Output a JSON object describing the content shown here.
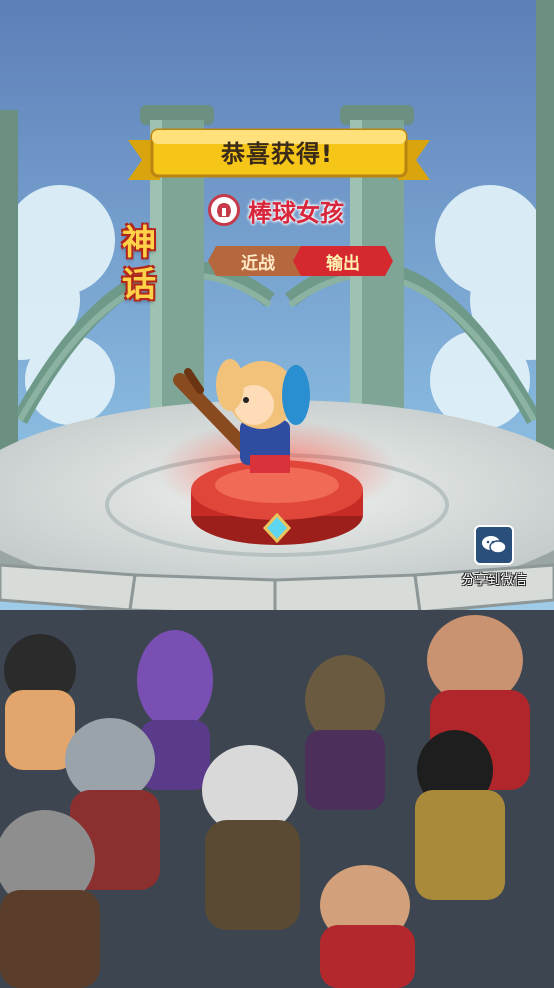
{
  "banner": {
    "title": "恭喜获得!"
  },
  "hero": {
    "name": "棒球女孩",
    "rarity_line1": "神",
    "rarity_line2": "话",
    "tags": [
      "近战",
      "输出"
    ]
  },
  "share": {
    "label": "分享到微信",
    "icon": "wechat-icon"
  },
  "colors": {
    "name": "#d8263d",
    "banner": "#f5c518",
    "rarity": "#ffd24a",
    "pedestal": "#d7322e"
  }
}
